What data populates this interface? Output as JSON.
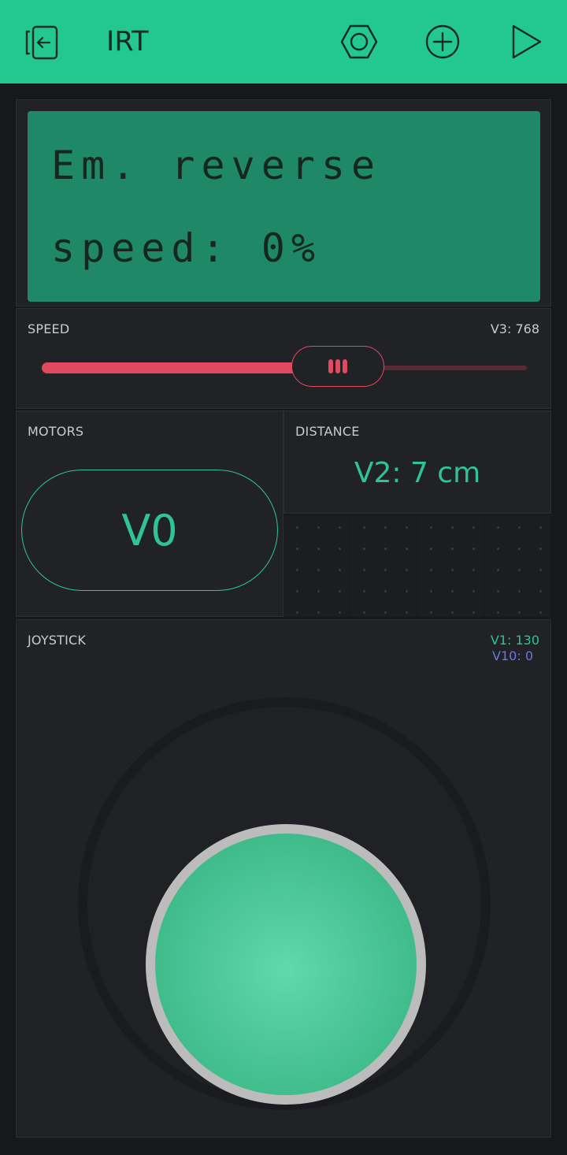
{
  "app": {
    "title": "IRT"
  },
  "toolbar": {
    "back_icon": "exit-project-icon",
    "settings_icon": "hexagon-nut-settings-icon",
    "add_icon": "plus-circle-icon",
    "play_icon": "play-icon"
  },
  "lcd": {
    "line1": "Em. reverse",
    "line2": "speed: 0%"
  },
  "speed": {
    "label": "SPEED",
    "value_text": "V3: 768",
    "fraction": 0.61
  },
  "motors": {
    "label": "MOTORS",
    "button_text": "V0"
  },
  "distance": {
    "label": "DISTANCE",
    "value_text": "V2: 7 cm"
  },
  "joystick": {
    "label": "JOYSTICK",
    "v1_text": "V1: 130",
    "v10_text": "V10: 0"
  },
  "colors": {
    "accent": "#23c890",
    "slider": "#e0495e",
    "value_green": "#2fc495",
    "value_blue": "#6b78e0",
    "lcd_bg": "#1f8866",
    "panel_bg": "#212226"
  }
}
